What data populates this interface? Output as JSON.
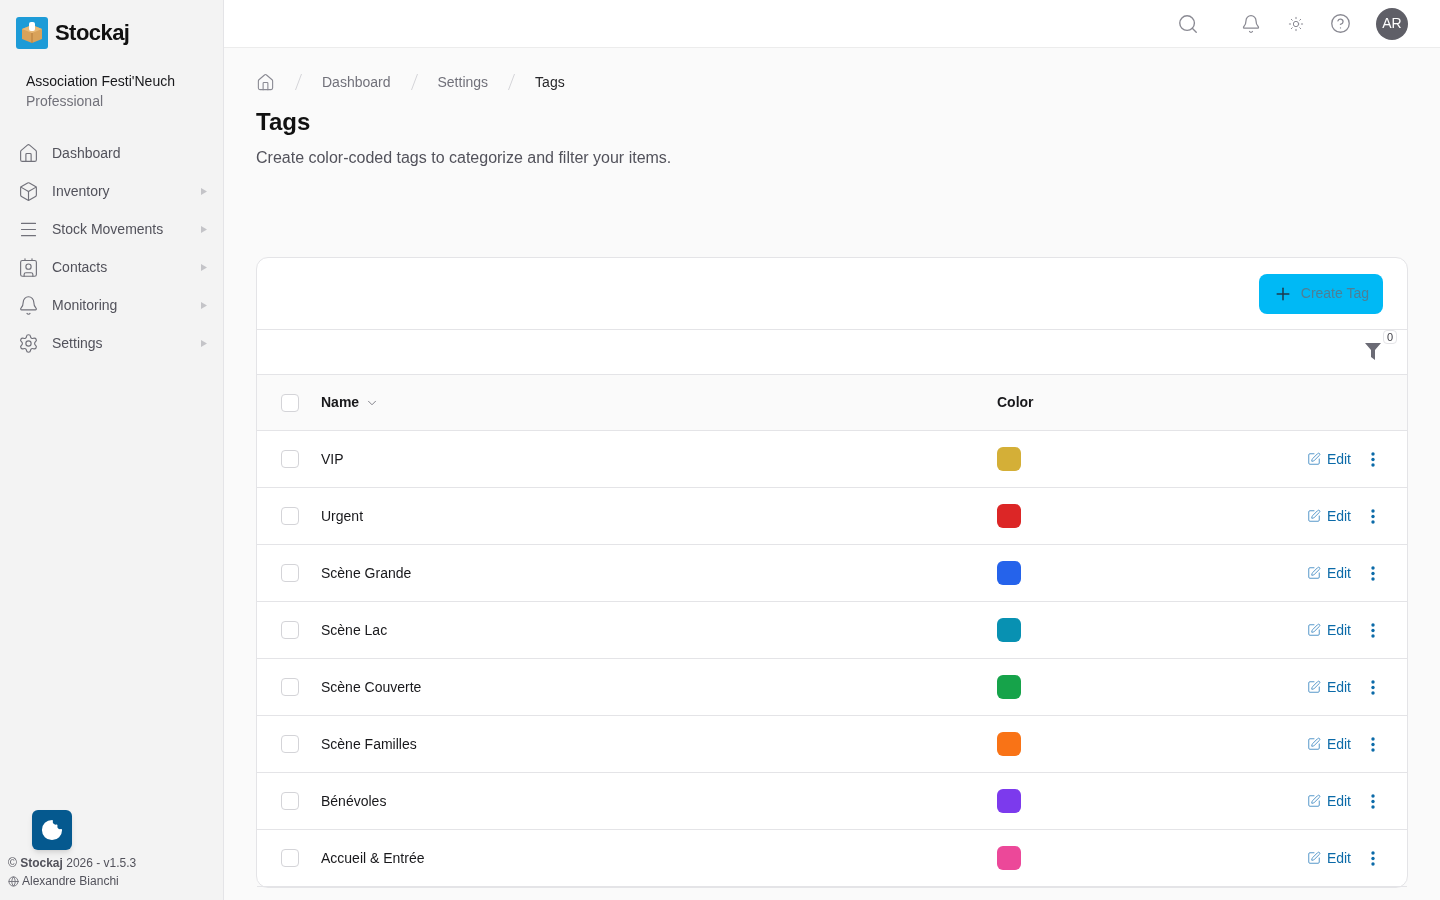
{
  "sidebar": {
    "brand": "Stockaj",
    "organization": "Association Festi'Neuch",
    "plan": "Professional",
    "items": [
      {
        "label": "Dashboard",
        "selected": false,
        "has_submenu": false
      },
      {
        "label": "Inventory",
        "selected": false,
        "has_submenu": true
      },
      {
        "label": "Stock Movements",
        "selected": false,
        "has_submenu": true
      },
      {
        "label": "Contacts",
        "selected": false,
        "has_submenu": true
      },
      {
        "label": "Monitoring",
        "selected": false,
        "has_submenu": true
      },
      {
        "label": "Settings",
        "selected": false,
        "has_submenu": true
      }
    ],
    "footer": {
      "copyright": "© **Stockaj** 2026 - v1.5.3",
      "user": "Alexandre Bianchi"
    }
  },
  "top_bar": {
    "avatar_initials": "AR"
  },
  "breadcrumb": [
    {
      "label": "Dashboard",
      "current": false
    },
    {
      "label": "Settings",
      "current": false
    },
    {
      "label": "Tags",
      "current": true
    }
  ],
  "page": {
    "title": "Tags",
    "description": "Create color-coded tags to categorize and filter your items."
  },
  "toolbar": {
    "create_button": "Create Tag",
    "filter_count": "0"
  },
  "table": {
    "header_checkbox": {
      "checked": false
    },
    "columns": [
      "Name",
      "Color"
    ],
    "rows": [
      {
        "name": "VIP",
        "color": "#d4af37",
        "checked": false,
        "action": "Edit"
      },
      {
        "name": "Urgent",
        "color": "#dc2626",
        "checked": false,
        "action": "Edit"
      },
      {
        "name": "Scène Grande",
        "color": "#2563eb",
        "checked": false,
        "action": "Edit"
      },
      {
        "name": "Scène Lac",
        "color": "#0891b2",
        "checked": false,
        "action": "Edit"
      },
      {
        "name": "Scène Couverte",
        "color": "#16a34a",
        "checked": false,
        "action": "Edit"
      },
      {
        "name": "Scène Familles",
        "color": "#f97316",
        "checked": false,
        "action": "Edit"
      },
      {
        "name": "Bénévoles",
        "color": "#7c3aed",
        "checked": false,
        "action": "Edit"
      },
      {
        "name": "Accueil & Entrée",
        "color": "#ec4899",
        "checked": false,
        "action": "Edit"
      }
    ]
  }
}
